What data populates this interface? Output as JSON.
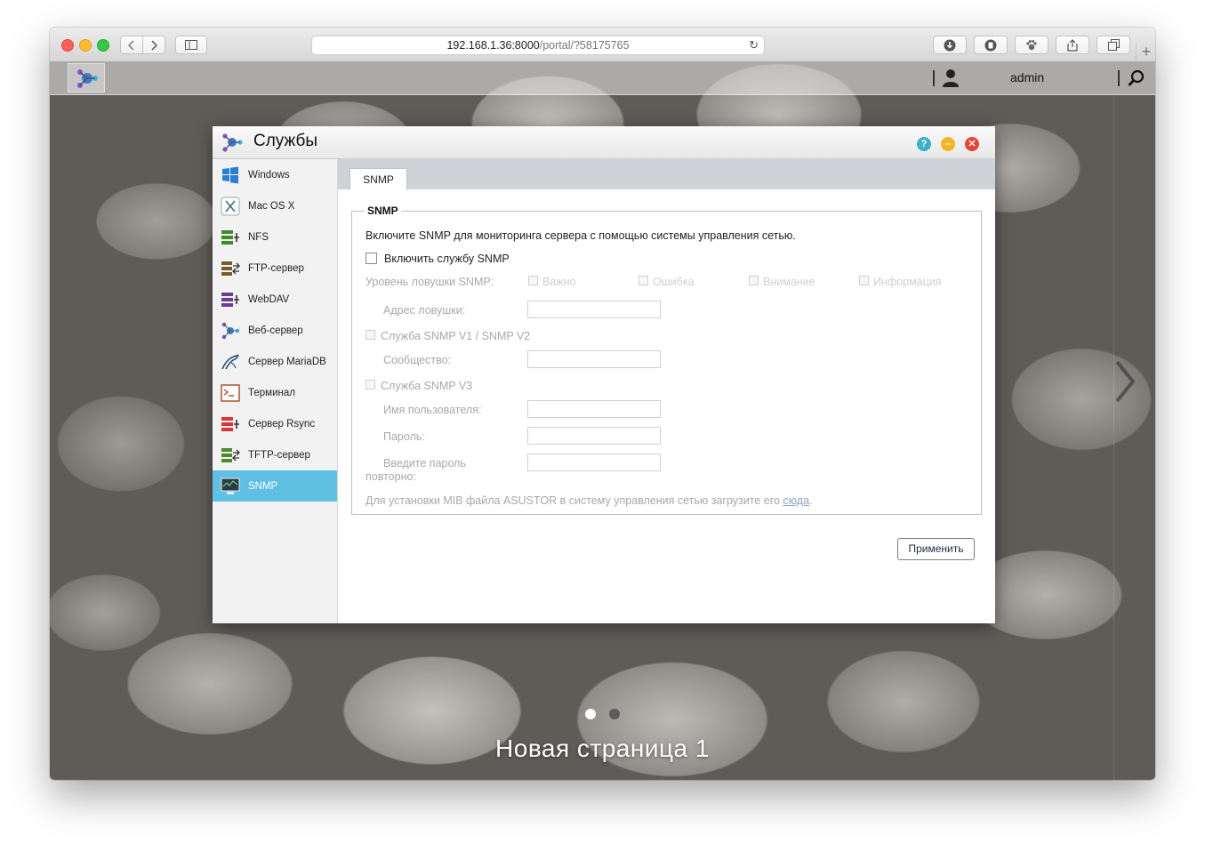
{
  "browser": {
    "url_host": "192.168.1.36:8000",
    "url_path": "/portal/?58175765",
    "newtab": "+"
  },
  "topbar": {
    "username": "admin"
  },
  "dialog": {
    "title": "Службы",
    "sidebar": [
      {
        "label": "Windows",
        "icon": "windows-icon"
      },
      {
        "label": "Mac OS X",
        "icon": "macosx-icon"
      },
      {
        "label": "NFS",
        "icon": "nfs-icon"
      },
      {
        "label": "FTP-сервер",
        "icon": "ftp-server-icon"
      },
      {
        "label": "WebDAV",
        "icon": "webdav-icon"
      },
      {
        "label": "Веб-сервер",
        "icon": "web-server-icon"
      },
      {
        "label": "Сервер MariaDB",
        "icon": "mariadb-icon"
      },
      {
        "label": "Терминал",
        "icon": "terminal-icon"
      },
      {
        "label": "Сервер Rsync",
        "icon": "rsync-icon"
      },
      {
        "label": "TFTP-сервер",
        "icon": "tftp-server-icon"
      },
      {
        "label": "SNMP",
        "icon": "snmp-icon",
        "active": true
      }
    ],
    "tab": "SNMP",
    "section": {
      "legend": "SNMP",
      "description": "Включите SNMP для мониторинга сервера с помощью системы управления сетью.",
      "enable_label": "Включить службу SNMP",
      "enable_checked": false,
      "trap_level_label": "Уровень ловушки SNMP:",
      "trap_levels": [
        "Важно",
        "Ошибка",
        "Внимание",
        "Информация"
      ],
      "trap_address_label": "Адрес ловушки:",
      "v1v2_label": "Служба SNMP V1 / SNMP V2",
      "community_label": "Сообщество:",
      "v3_label": "Служба SNMP V3",
      "username_label": "Имя пользователя:",
      "password_label": "Пароль:",
      "password_confirm_label_1": "Введите пароль",
      "password_confirm_label_2": "повторно:",
      "mib_text": "Для установки MIB файла ASUSTOR в систему управления сетью загрузите его ",
      "mib_link": "сюда",
      "mib_end": "."
    },
    "apply_label": "Применить"
  },
  "desktop": {
    "page_label": "Новая страница 1",
    "page_count": 2,
    "current_page": 1
  },
  "colors": {
    "accent": "#5fc0e4",
    "help": "#3db0c9",
    "minimize": "#f0b625",
    "close": "#e8433b"
  }
}
